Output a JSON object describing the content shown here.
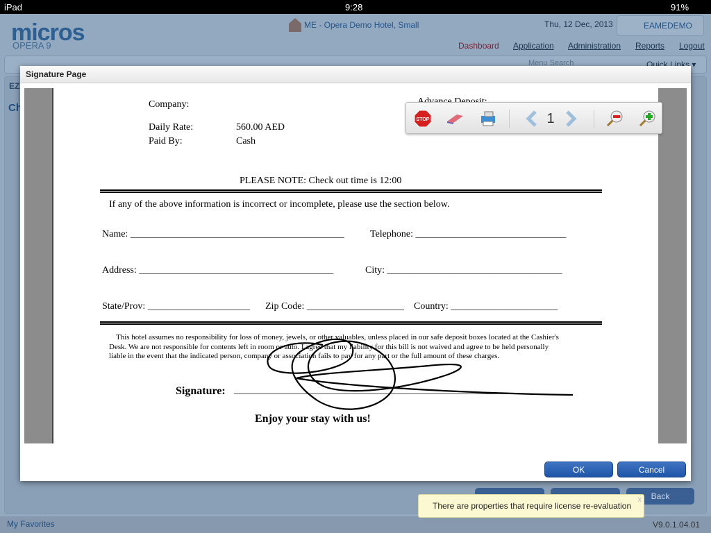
{
  "status_bar": {
    "device": "iPad",
    "time": "9:28",
    "battery": "91%"
  },
  "header": {
    "logo": "micros",
    "logo_sub": "OPERA 9",
    "hotel": "ME - Opera Demo Hotel, Small",
    "date": "Thu, 12 Dec, 2013",
    "user": "EAMEDEMO",
    "nav": [
      "Dashboard",
      "Application",
      "Administration",
      "Reports",
      "Logout"
    ],
    "menu_search_placeholder": "Menu Search",
    "quick_links": "Quick Links ▾"
  },
  "background": {
    "tab": "EZ",
    "title": "Ch",
    "back": "Back",
    "version": "V9.0.1.04.01",
    "favorites": "My Favorites"
  },
  "modal": {
    "title": "Signature Page",
    "ok": "OK",
    "cancel": "Cancel"
  },
  "pdf_toolbar": {
    "page": "1",
    "icons": [
      "stop-icon",
      "eraser-icon",
      "printer-icon",
      "chevron-left-icon",
      "chevron-right-icon",
      "zoom-out-icon",
      "zoom-in-icon"
    ]
  },
  "document": {
    "company_label": "Company:",
    "advance_deposit_label": "Advance Deposit:",
    "daily_rate_label": "Daily Rate:",
    "daily_rate": "560.00 AED",
    "paid_by_label": "Paid By:",
    "paid_by": "Cash",
    "note": "PLEASE NOTE: Check out time is 12:00",
    "instruction": "If any of the above information is incorrect or incomplete, please use the section below.",
    "name": "Name:  ____________________________________________",
    "telephone": "Telephone: _______________________________",
    "address": "Address: ________________________________________",
    "city": "City: ____________________________________",
    "state": "State/Prov: _____________________",
    "zip": "Zip Code: ____________________",
    "country": "Country: ______________________",
    "disclaimer": "This hotel assumes no responsibility for loss of money, jewels, or other valuables, unless placed in our safe deposit boxes located at the Cashier's Desk.  We are not responsible for contents left in room or auto.  I agree that my liability for this bill is not waived and agree to be held personally liable in the event that the indicated person, company or association fails to pay for any part or the full amount of these charges.",
    "signature_label": "Signature:",
    "signature_line": "__________________________________________________________",
    "closing": "Enjoy your stay with us!"
  },
  "toast": {
    "message": "There are properties that require license re-evaluation",
    "close": "x"
  }
}
